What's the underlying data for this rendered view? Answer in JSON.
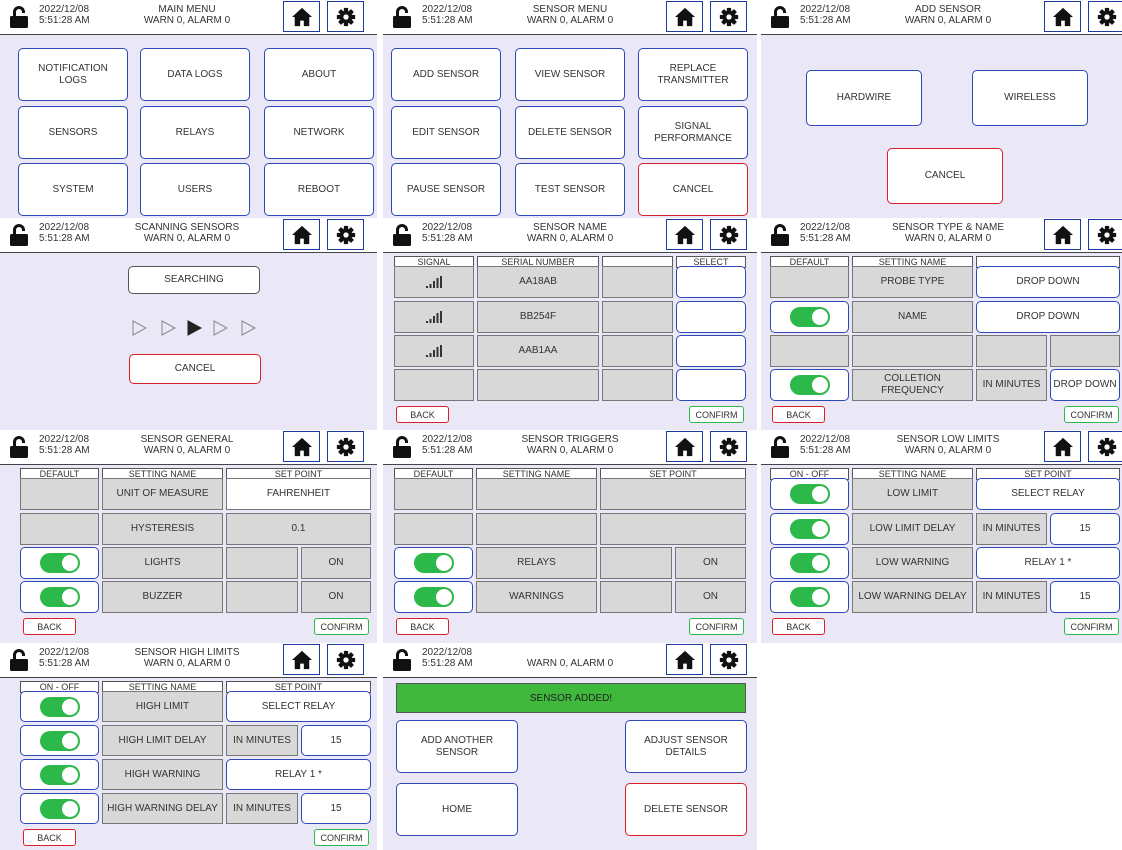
{
  "header": {
    "date": "2022/12/08",
    "time": "5:51:28 AM",
    "status": "WARN 0, ALARM 0"
  },
  "icons": {
    "lock": "unlock-icon",
    "home": "home-icon",
    "gear": "gear-icon",
    "signal": "signal-bars-icon",
    "play": "play-triangle-icon"
  },
  "colors": {
    "button_border": "#2e48b8",
    "cancel_border": "#d8202a",
    "toggle_on": "#2db84a",
    "panel_bg": "#eae8f6",
    "banner": "#3fb83c"
  },
  "common": {
    "back": "BACK",
    "confirm": "CONFIRM",
    "cancel": "CANCEL"
  },
  "main_menu": {
    "title": "MAIN MENU",
    "buttons": [
      "NOTIFICATION LOGS",
      "DATA LOGS",
      "ABOUT",
      "SENSORS",
      "RELAYS",
      "NETWORK",
      "SYSTEM",
      "USERS",
      "REBOOT"
    ]
  },
  "sensor_menu": {
    "title": "SENSOR MENU",
    "buttons": [
      "ADD SENSOR",
      "VIEW SENSOR",
      "REPLACE TRANSMITTER",
      "EDIT SENSOR",
      "DELETE SENSOR",
      "SIGNAL PERFORMANCE",
      "PAUSE SENSOR",
      "TEST SENSOR",
      "CANCEL"
    ]
  },
  "add_sensor": {
    "title": "ADD SENSOR",
    "hardwire": "HARDWIRE",
    "wireless": "WIRELESS",
    "cancel": "CANCEL"
  },
  "scanning": {
    "title": "SCANNING SENSORS",
    "searching": "SEARCHING",
    "cancel": "CANCEL"
  },
  "sensor_name": {
    "title": "SENSOR NAME",
    "columns": [
      "SIGNAL",
      "SERIAL NUMBER",
      "",
      "SELECT"
    ],
    "serials": [
      "AA18AB",
      "BB254F",
      "AAB1AA"
    ]
  },
  "type_name": {
    "title": "SENSOR TYPE & NAME",
    "columns": [
      "DEFAULT",
      "SETTING NAME",
      ""
    ],
    "probe_type": "PROBE TYPE",
    "name": "NAME",
    "drop_down": "DROP DOWN",
    "frequency": "COLLETION FREQUENCY",
    "in_minutes": "IN MINUTES"
  },
  "general": {
    "title": "SENSOR GENERAL",
    "columns": [
      "DEFAULT",
      "SETTING NAME",
      "SET POINT"
    ],
    "unit_of_measure": "UNIT OF MEASURE",
    "fahrenheit": "FAHRENHEIT",
    "hysteresis": "HYSTERESIS",
    "hysteresis_value": "0.1",
    "lights": "LIGHTS",
    "buzzer": "BUZZER",
    "on": "ON"
  },
  "triggers": {
    "title": "SENSOR TRIGGERS",
    "columns": [
      "DEFAULT",
      "SETTING NAME",
      "SET POINT"
    ],
    "relays": "RELAYS",
    "warnings": "WARNINGS",
    "on": "ON"
  },
  "low_limits": {
    "title": "SENSOR LOW LIMITS",
    "columns": [
      "ON - OFF",
      "SETTING NAME",
      "SET POINT"
    ],
    "low_limit": "LOW LIMIT",
    "select_relay": "SELECT RELAY",
    "low_limit_delay": "LOW LIMIT DELAY",
    "in_minutes": "IN MINUTES",
    "minutes_value": "15",
    "low_warning": "LOW WARNING",
    "relay1": "RELAY 1 *",
    "low_warning_delay": "LOW WARNING DELAY"
  },
  "high_limits": {
    "title": "SENSOR HIGH LIMITS",
    "columns": [
      "ON - OFF",
      "SETTING NAME",
      "SET POINT"
    ],
    "high_limit": "HIGH LIMIT",
    "select_relay": "SELECT RELAY",
    "high_limit_delay": "HIGH LIMIT DELAY",
    "in_minutes": "IN MINUTES",
    "minutes_value": "15",
    "high_warning": "HIGH WARNING",
    "relay1": "RELAY 1 *",
    "high_warning_delay": "HIGH WARNING DELAY"
  },
  "added": {
    "banner": "SENSOR ADDED!",
    "add_another": "ADD ANOTHER SENSOR",
    "adjust": "ADJUST SENSOR DETAILS",
    "home": "HOME",
    "delete": "DELETE SENSOR"
  }
}
